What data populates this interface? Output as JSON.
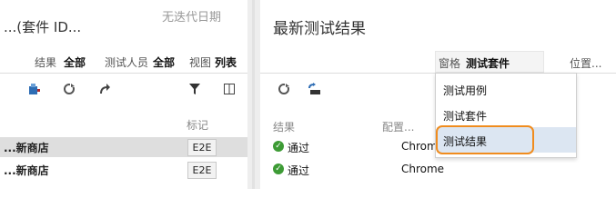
{
  "left_pane": {
    "suite_title": "...(套件 ID...",
    "no_iteration": "无迭代日期",
    "filters": {
      "result_label": "结果",
      "result_value": "全部",
      "tester_label": "测试人员",
      "tester_value": "全部",
      "view_label": "视图",
      "view_value": "列表"
    },
    "column_header": "标记",
    "rows": [
      {
        "name": "...新商店",
        "tag": "E2E"
      },
      {
        "name": "...新商店",
        "tag": "E2E"
      }
    ]
  },
  "right_pane": {
    "title": "最新测试结果",
    "pane_label": "窗格",
    "pane_value": "测试套件",
    "position_label": "位置...",
    "col_result": "结果",
    "col_config": "配置...",
    "results": [
      {
        "outcome": "通过",
        "config": "Chrome"
      },
      {
        "outcome": "通过",
        "config": "Chrome"
      }
    ]
  },
  "dropdown": {
    "options": [
      "测试用例",
      "测试套件",
      "测试结果"
    ],
    "selected": "测试结果"
  },
  "colors": {
    "highlight_ring": "#f08c1e",
    "pass_green": "#3d9b35",
    "selected_row": "#dedede"
  }
}
